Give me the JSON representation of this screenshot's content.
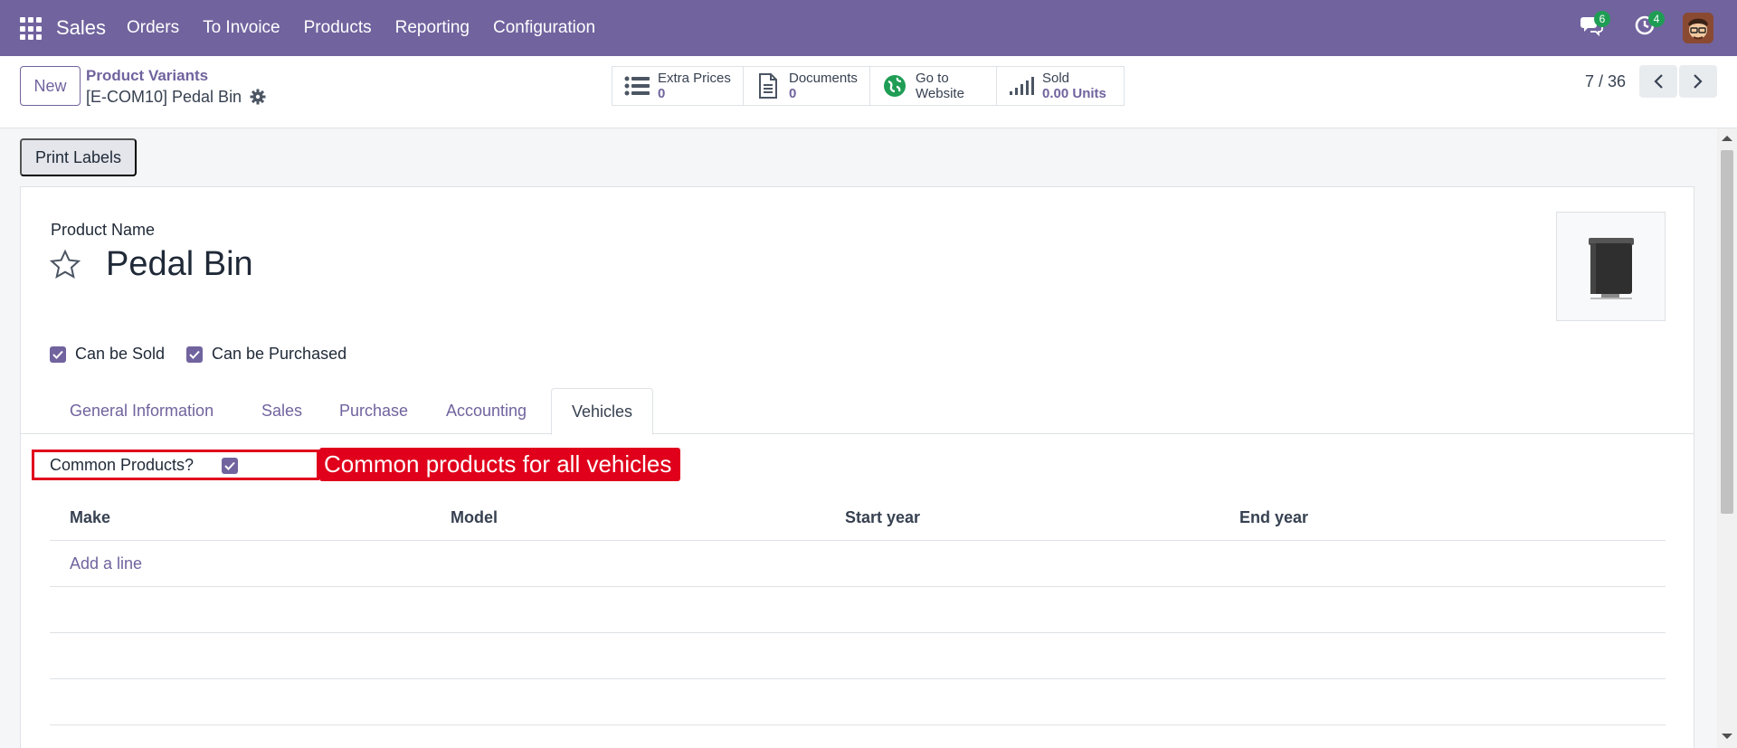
{
  "navbar": {
    "app_name": "Sales",
    "menu": [
      "Orders",
      "To Invoice",
      "Products",
      "Reporting",
      "Configuration"
    ],
    "messages_count": "6",
    "activities_count": "4"
  },
  "control_panel": {
    "new_label": "New",
    "breadcrumb_parent": "Product Variants",
    "breadcrumb_current": "[E-COM10] Pedal Bin",
    "smart_buttons": [
      {
        "label": "Extra Prices",
        "value": "0",
        "icon": "list-icon"
      },
      {
        "label": "Documents",
        "value": "0",
        "icon": "document-icon"
      },
      {
        "label": "Go to",
        "label2": "Website",
        "icon": "globe-icon"
      },
      {
        "label": "Sold",
        "value": "0.00 Units",
        "icon": "signal-bars-icon"
      }
    ],
    "pager": "7 / 36"
  },
  "actions": {
    "print_labels": "Print Labels"
  },
  "form": {
    "product_name_label": "Product Name",
    "product_name": "Pedal Bin",
    "can_be_sold_label": "Can be Sold",
    "can_be_purchased_label": "Can be Purchased",
    "tabs": [
      "General Information",
      "Sales",
      "Purchase",
      "Accounting",
      "Vehicles"
    ],
    "active_tab": "Vehicles",
    "common_products_label": "Common Products?",
    "callout": "Common products for all vehicles",
    "table": {
      "columns": [
        "Make",
        "Model",
        "Start year",
        "End year"
      ],
      "add_line": "Add a line"
    }
  },
  "colors": {
    "brand": "#71639e",
    "callout_red": "#e0001b",
    "badge_green": "#1f9d55"
  }
}
